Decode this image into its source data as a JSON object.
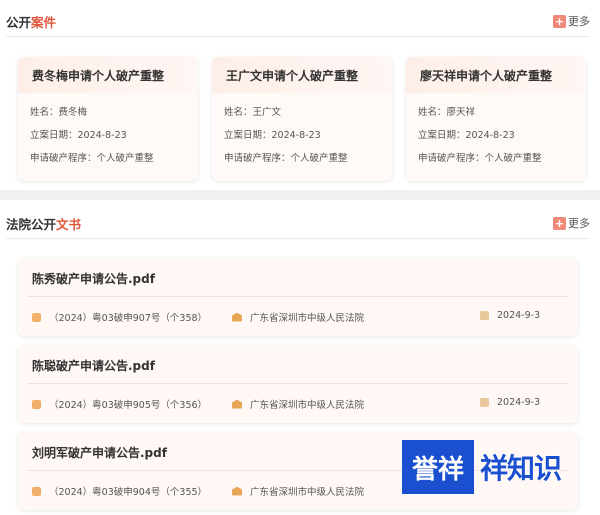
{
  "section1": {
    "title_plain": "公开",
    "title_highlight": "案件",
    "more_label": "更多",
    "cards": [
      {
        "title": "费冬梅申请个人破产重整",
        "name_row": "姓名：费冬梅",
        "date_row": "立案日期：2024-8-23",
        "proc_row": "申请破产程序：个人破产重整"
      },
      {
        "title": "王广文申请个人破产重整",
        "name_row": "姓名：王广文",
        "date_row": "立案日期：2024-8-23",
        "proc_row": "申请破产程序：个人破产重整"
      },
      {
        "title": "廖天祥申请个人破产重整",
        "name_row": "姓名：廖天祥",
        "date_row": "立案日期：2024-8-23",
        "proc_row": "申请破产程序：个人破产重整"
      }
    ]
  },
  "section2": {
    "title_plain": "法院公开",
    "title_highlight": "文书",
    "more_label": "更多",
    "docs": [
      {
        "title": "陈秀破产申请公告.pdf",
        "case_no": "（2024）粤03破申907号（个358）",
        "court": "广东省深圳市中级人民法院",
        "date": "2024-9-3"
      },
      {
        "title": "陈聪破产申请公告.pdf",
        "case_no": "（2024）粤03破申905号（个356）",
        "court": "广东省深圳市中级人民法院",
        "date": "2024-9-3"
      },
      {
        "title": "刘明军破产申请公告.pdf",
        "case_no": "（2024）粤03破申904号（个355）",
        "court": "广东省深圳市中级人民法院",
        "date": ""
      }
    ]
  },
  "watermark": {
    "box_text": "誉祥",
    "text": "祥知识"
  },
  "colors": {
    "accent": "#e0563a",
    "brand_blue": "#1a4fd0"
  }
}
